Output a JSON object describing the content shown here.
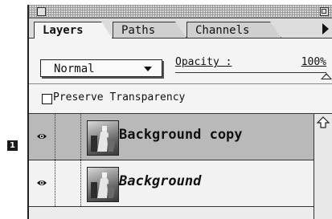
{
  "tabs": [
    {
      "label": "Layers",
      "active": true
    },
    {
      "label": "Paths",
      "active": false
    },
    {
      "label": "Channels",
      "active": false
    }
  ],
  "blend_mode": {
    "selected": "Normal"
  },
  "opacity": {
    "label": "Opacity :",
    "value": "100%"
  },
  "preserve_transparency": {
    "label": "Preserve Transparency",
    "checked": false
  },
  "layers": [
    {
      "name": "Background copy",
      "selected": true,
      "visible": true
    },
    {
      "name": "Background",
      "selected": false,
      "visible": true
    }
  ],
  "callout": {
    "number": "1"
  },
  "icons": {
    "visibility": "eye-icon",
    "menu": "triangle-right-icon",
    "scroll_up": "arrow-up-icon",
    "close": "close-box-icon",
    "zoom": "zoom-box-icon"
  },
  "colors": {
    "selected_row": "#b9b9b9",
    "panel": "#f4f4f4",
    "frame": "#222222"
  }
}
